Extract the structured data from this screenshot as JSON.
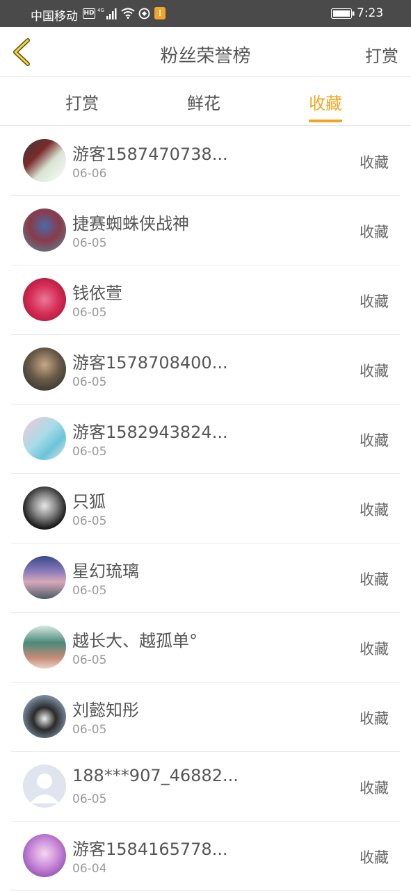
{
  "status_bar": {
    "carrier": "中国移动",
    "hd": "HD",
    "network": "4G",
    "notice": "!",
    "time": "7:23"
  },
  "header": {
    "title": "粉丝荣誉榜",
    "right_link": "打赏"
  },
  "tabs": [
    {
      "label": "打赏",
      "active": false
    },
    {
      "label": "鲜花",
      "active": false
    },
    {
      "label": "收藏",
      "active": true
    }
  ],
  "accent_color": "#f2a51c",
  "fans": [
    {
      "name": "游客1587470738...",
      "date": "06-06",
      "action": "收藏"
    },
    {
      "name": "捷赛蜘蛛侠战神",
      "date": "06-05",
      "action": "收藏"
    },
    {
      "name": "钱依萱",
      "date": "06-05",
      "action": "收藏"
    },
    {
      "name": "游客1578708400...",
      "date": "06-05",
      "action": "收藏"
    },
    {
      "name": "游客1582943824...",
      "date": "06-05",
      "action": "收藏"
    },
    {
      "name": "只狐",
      "date": "06-05",
      "action": "收藏"
    },
    {
      "name": "星幻琉璃",
      "date": "06-05",
      "action": "收藏"
    },
    {
      "name": "越长大、越孤单°",
      "date": "06-05",
      "action": "收藏"
    },
    {
      "name": "刘懿知彤",
      "date": "06-05",
      "action": "收藏"
    },
    {
      "name": "188***907_46882...",
      "date": "06-05",
      "action": "收藏"
    },
    {
      "name": "游客1584165778...",
      "date": "06-04",
      "action": "收藏"
    }
  ]
}
